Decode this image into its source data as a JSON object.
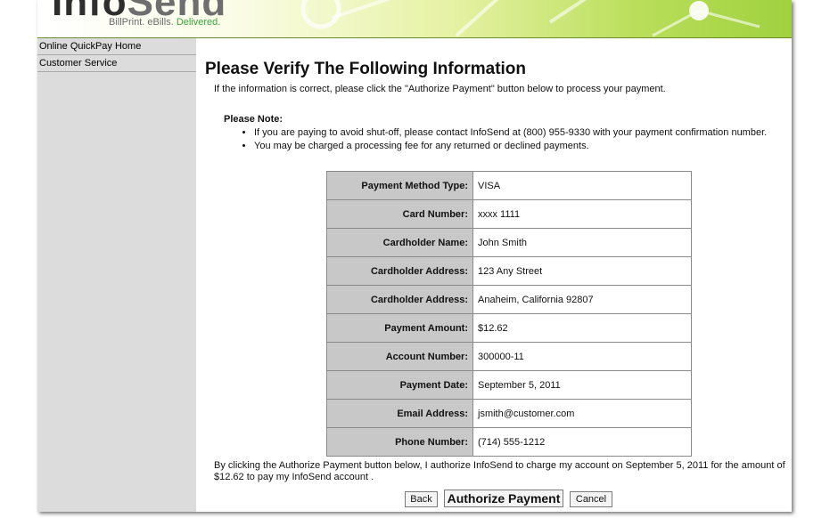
{
  "header": {
    "logo_part1": "Info",
    "logo_part2": "Send",
    "tagline_part1": "BillPrint. eBills.",
    "tagline_part2": "Delivered."
  },
  "sidebar": {
    "items": [
      {
        "label": "Online QuickPay Home"
      },
      {
        "label": "Customer Service"
      }
    ]
  },
  "page": {
    "title": "Please Verify The Following Information",
    "intro": "If the information is correct, please click the \"Authorize Payment\" button below to process your payment.",
    "note_heading": "Please Note:",
    "notes": [
      "If you are paying to avoid shut-off, please contact InfoSend at (800) 955-9330 with your payment confirmation number.",
      "You may be charged a processing fee for any returned or declined payments."
    ]
  },
  "payment_info": [
    {
      "label": "Payment Method Type:",
      "value": "VISA"
    },
    {
      "label": "Card Number:",
      "value": "xxxx 1111"
    },
    {
      "label": "Cardholder Name:",
      "value": "John Smith"
    },
    {
      "label": "Cardholder Address:",
      "value": "123 Any Street"
    },
    {
      "label": "Cardholder Address:",
      "value": "Anaheim, California 92807"
    },
    {
      "label": "Payment Amount:",
      "value": "$12.62"
    },
    {
      "label": "Account Number:",
      "value": "300000-11"
    },
    {
      "label": "Payment Date:",
      "value": "September 5, 2011"
    },
    {
      "label": "Email Address:",
      "value": "jsmith@customer.com"
    },
    {
      "label": "Phone Number:",
      "value": "(714) 555-1212"
    }
  ],
  "authorization_text": "By clicking the Authorize Payment button below, I authorize InfoSend to charge my account on September 5, 2011 for the amount of $12.62 to pay my InfoSend account .",
  "buttons": {
    "back": "Back",
    "authorize": "Authorize Payment",
    "cancel": "Cancel"
  },
  "colors": {
    "header_green": "#9fd13e",
    "sidebar_gray": "#dcdcdc",
    "label_cell_gray": "#c8c8c8"
  }
}
